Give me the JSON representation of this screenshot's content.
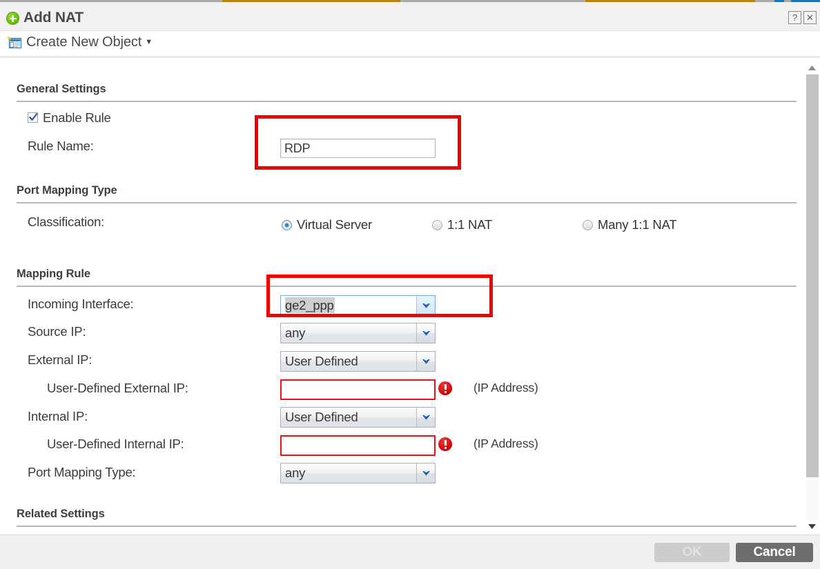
{
  "window": {
    "title": "Add NAT",
    "help_button": "?",
    "close_button": "✕"
  },
  "toolbar": {
    "create_object_label": "Create New Object",
    "caret": "▼",
    "icon": "create-new-object-icon"
  },
  "sections": {
    "general": {
      "heading": "General Settings",
      "enable_rule_label": "Enable Rule",
      "enable_rule_checked": true,
      "rule_name_label": "Rule Name:",
      "rule_name_value": "RDP"
    },
    "port_mapping_type": {
      "heading": "Port Mapping Type",
      "classification_label": "Classification:",
      "options": [
        {
          "label": "Virtual Server",
          "selected": true
        },
        {
          "label": "1:1 NAT",
          "selected": false
        },
        {
          "label": "Many 1:1 NAT",
          "selected": false
        }
      ]
    },
    "mapping_rule": {
      "heading": "Mapping Rule",
      "incoming_interface_label": "Incoming Interface:",
      "incoming_interface_value": "ge2_ppp",
      "source_ip_label": "Source IP:",
      "source_ip_value": "any",
      "external_ip_label": "External IP:",
      "external_ip_value": "User Defined",
      "user_defined_external_ip_label": "User-Defined External IP:",
      "user_defined_external_ip_value": "",
      "user_defined_external_ip_hint": "(IP Address)",
      "internal_ip_label": "Internal IP:",
      "internal_ip_value": "User Defined",
      "user_defined_internal_ip_label": "User-Defined Internal IP:",
      "user_defined_internal_ip_value": "",
      "user_defined_internal_ip_hint": "(IP Address)",
      "port_mapping_type_label": "Port Mapping Type:",
      "port_mapping_type_value": "any"
    },
    "related": {
      "heading": "Related Settings"
    }
  },
  "footer": {
    "ok_label": "OK",
    "cancel_label": "Cancel"
  },
  "colors": {
    "annotation_red": "#f00000",
    "error_red": "#ee1111",
    "accent_gold": "#b8860b",
    "accent_blue": "#1a74b0",
    "add_green": "#63bd12",
    "cancel_gray": "#6e6e6e"
  }
}
